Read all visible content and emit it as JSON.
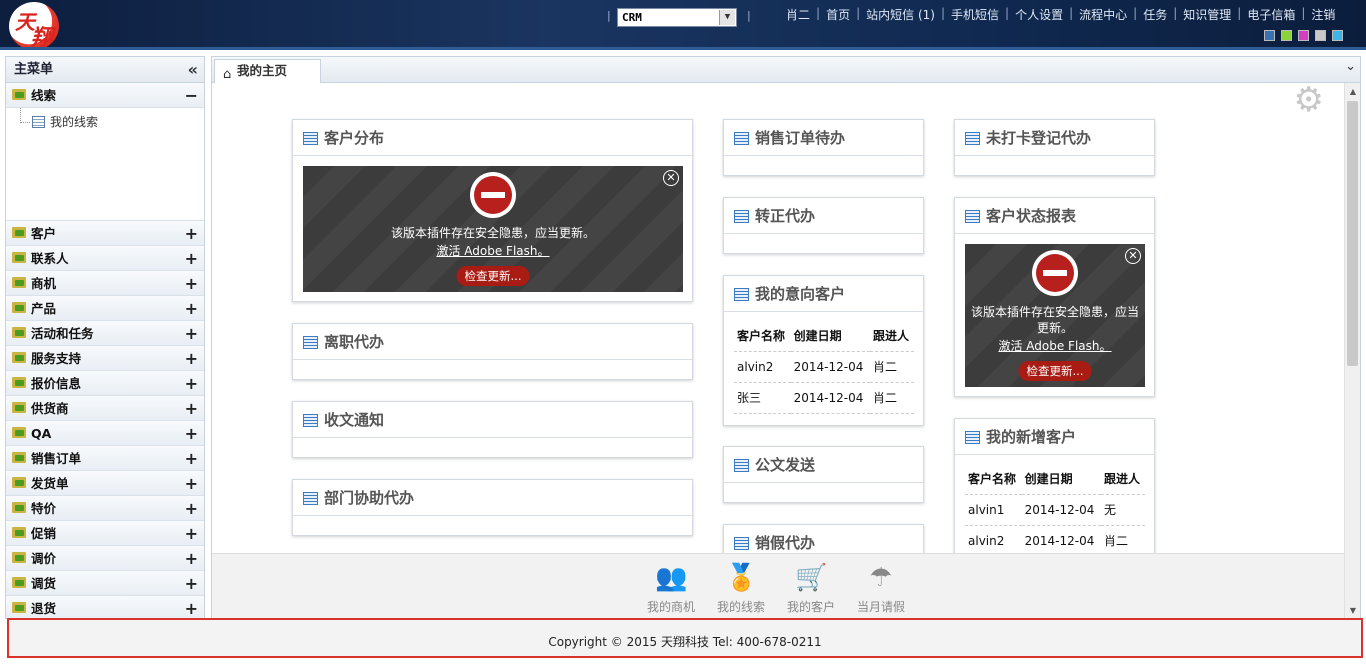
{
  "header": {
    "logo_text_1": "天",
    "logo_text_2": "翔",
    "system_select": "CRM",
    "nav": [
      "肖二",
      "首页",
      "站内短信 (1)",
      "手机短信",
      "个人设置",
      "流程中心",
      "任务",
      "知识管理",
      "电子信箱",
      "注销"
    ],
    "skin_colors": [
      "#3a6fb0",
      "#8cd23b",
      "#d33fc0",
      "#c8c8c8",
      "#3db6e6"
    ]
  },
  "sidebar": {
    "title": "主菜单",
    "expanded_group": "线索",
    "expanded_items": [
      "我的线索"
    ],
    "groups": [
      "客户",
      "联系人",
      "商机",
      "产品",
      "活动和任务",
      "服务支持",
      "报价信息",
      "供货商",
      "QA",
      "销售订单",
      "发货单",
      "特价",
      "促销",
      "调价",
      "调货",
      "退货"
    ]
  },
  "tab": {
    "label": "我的主页"
  },
  "widgets": {
    "customer_distribution": "客户分布",
    "resign_todo": "离职代办",
    "doc_receive": "收文通知",
    "dept_assist": "部门协助代办",
    "sales_order_todo": "销售订单待办",
    "regular_todo": "转正代办",
    "intent_customers": "我的意向客户",
    "doc_send": "公文发送",
    "leave_cancel": "销假代办",
    "no_clock_todo": "未打卡登记代办",
    "customer_status_report": "客户状态报表",
    "new_customers": "我的新增客户"
  },
  "flash": {
    "message_wide": "该版本插件存在安全隐患，应当更新。",
    "message_narrow_1": "该版本插件存在安全隐患，应当",
    "message_narrow_2": "更新。",
    "activate": "激活 Adobe Flash。",
    "check": "检查更新..."
  },
  "intent_table": {
    "headers": [
      "客户名称",
      "创建日期",
      "跟进人"
    ],
    "rows": [
      [
        "alvin2",
        "2014-12-04",
        "肖二"
      ],
      [
        "张三",
        "2014-12-04",
        "肖二"
      ]
    ]
  },
  "new_customer_table": {
    "headers": [
      "客户名称",
      "创建日期",
      "跟进人"
    ],
    "rows": [
      [
        "alvin1",
        "2014-12-04",
        "无"
      ],
      [
        "alvin2",
        "2014-12-04",
        "肖二"
      ]
    ]
  },
  "quick": [
    "我的商机",
    "我的线索",
    "我的客户",
    "当月请假"
  ],
  "footer": "Copyright © 2015 天翔科技 Tel: 400-678-0211"
}
